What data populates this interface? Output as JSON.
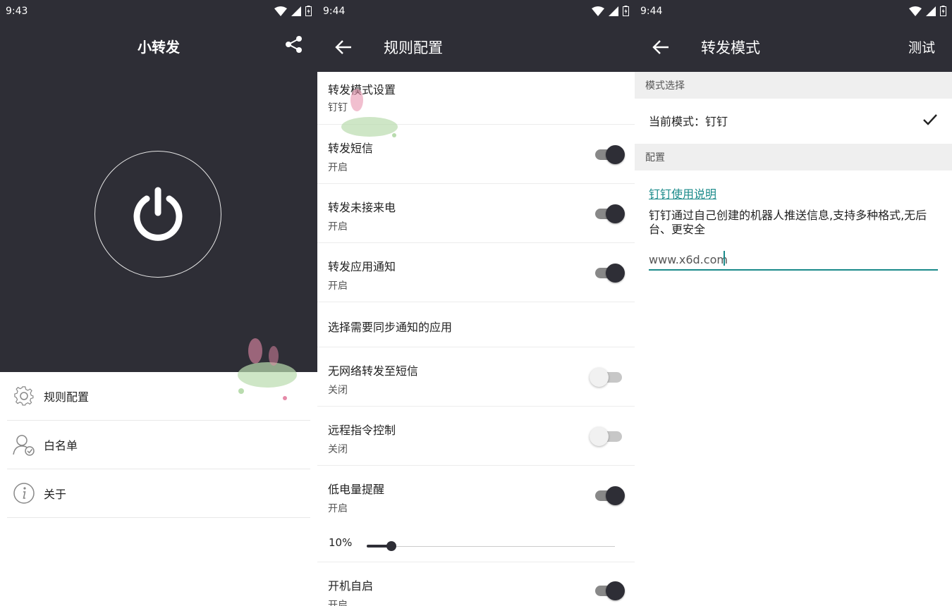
{
  "screen1": {
    "status_time": "9:43",
    "title": "小转发",
    "menu": [
      {
        "label": "规则配置",
        "icon": "gear-icon"
      },
      {
        "label": "白名单",
        "icon": "user-check-icon"
      },
      {
        "label": "关于",
        "icon": "info-icon"
      }
    ]
  },
  "screen2": {
    "status_time": "9:44",
    "title": "规则配置",
    "rows": [
      {
        "title": "转发模式设置",
        "sub": "钉钉"
      },
      {
        "title": "转发短信",
        "sub": "开启",
        "switch": true
      },
      {
        "title": "转发未接来电",
        "sub": "开启",
        "switch": true
      },
      {
        "title": "转发应用通知",
        "sub": "开启",
        "switch": true
      },
      {
        "title": "选择需要同步通知的应用"
      },
      {
        "title": "无网络转发至短信",
        "sub": "关闭",
        "switch": false
      },
      {
        "title": "远程指令控制",
        "sub": "关闭",
        "switch": false
      },
      {
        "title": "低电量提醒",
        "sub": "开启",
        "switch": true
      }
    ],
    "battery_slider": {
      "label": "10%",
      "value": 0.1
    },
    "last_row": {
      "title": "开机自启",
      "sub": "开启",
      "switch": true
    }
  },
  "screen3": {
    "status_time": "9:44",
    "title": "转发模式",
    "action": "测试",
    "section_mode": "模式选择",
    "current_mode": "当前模式：钉钉",
    "section_config": "配置",
    "help_link": "钉钉使用说明",
    "description": "钉钉通过自己创建的机器人推送信息,支持多种格式,无后台、更安全",
    "input_value": "www.x6d.com"
  },
  "colors": {
    "dark": "#2e2e36",
    "accent": "#1a8a8a"
  }
}
